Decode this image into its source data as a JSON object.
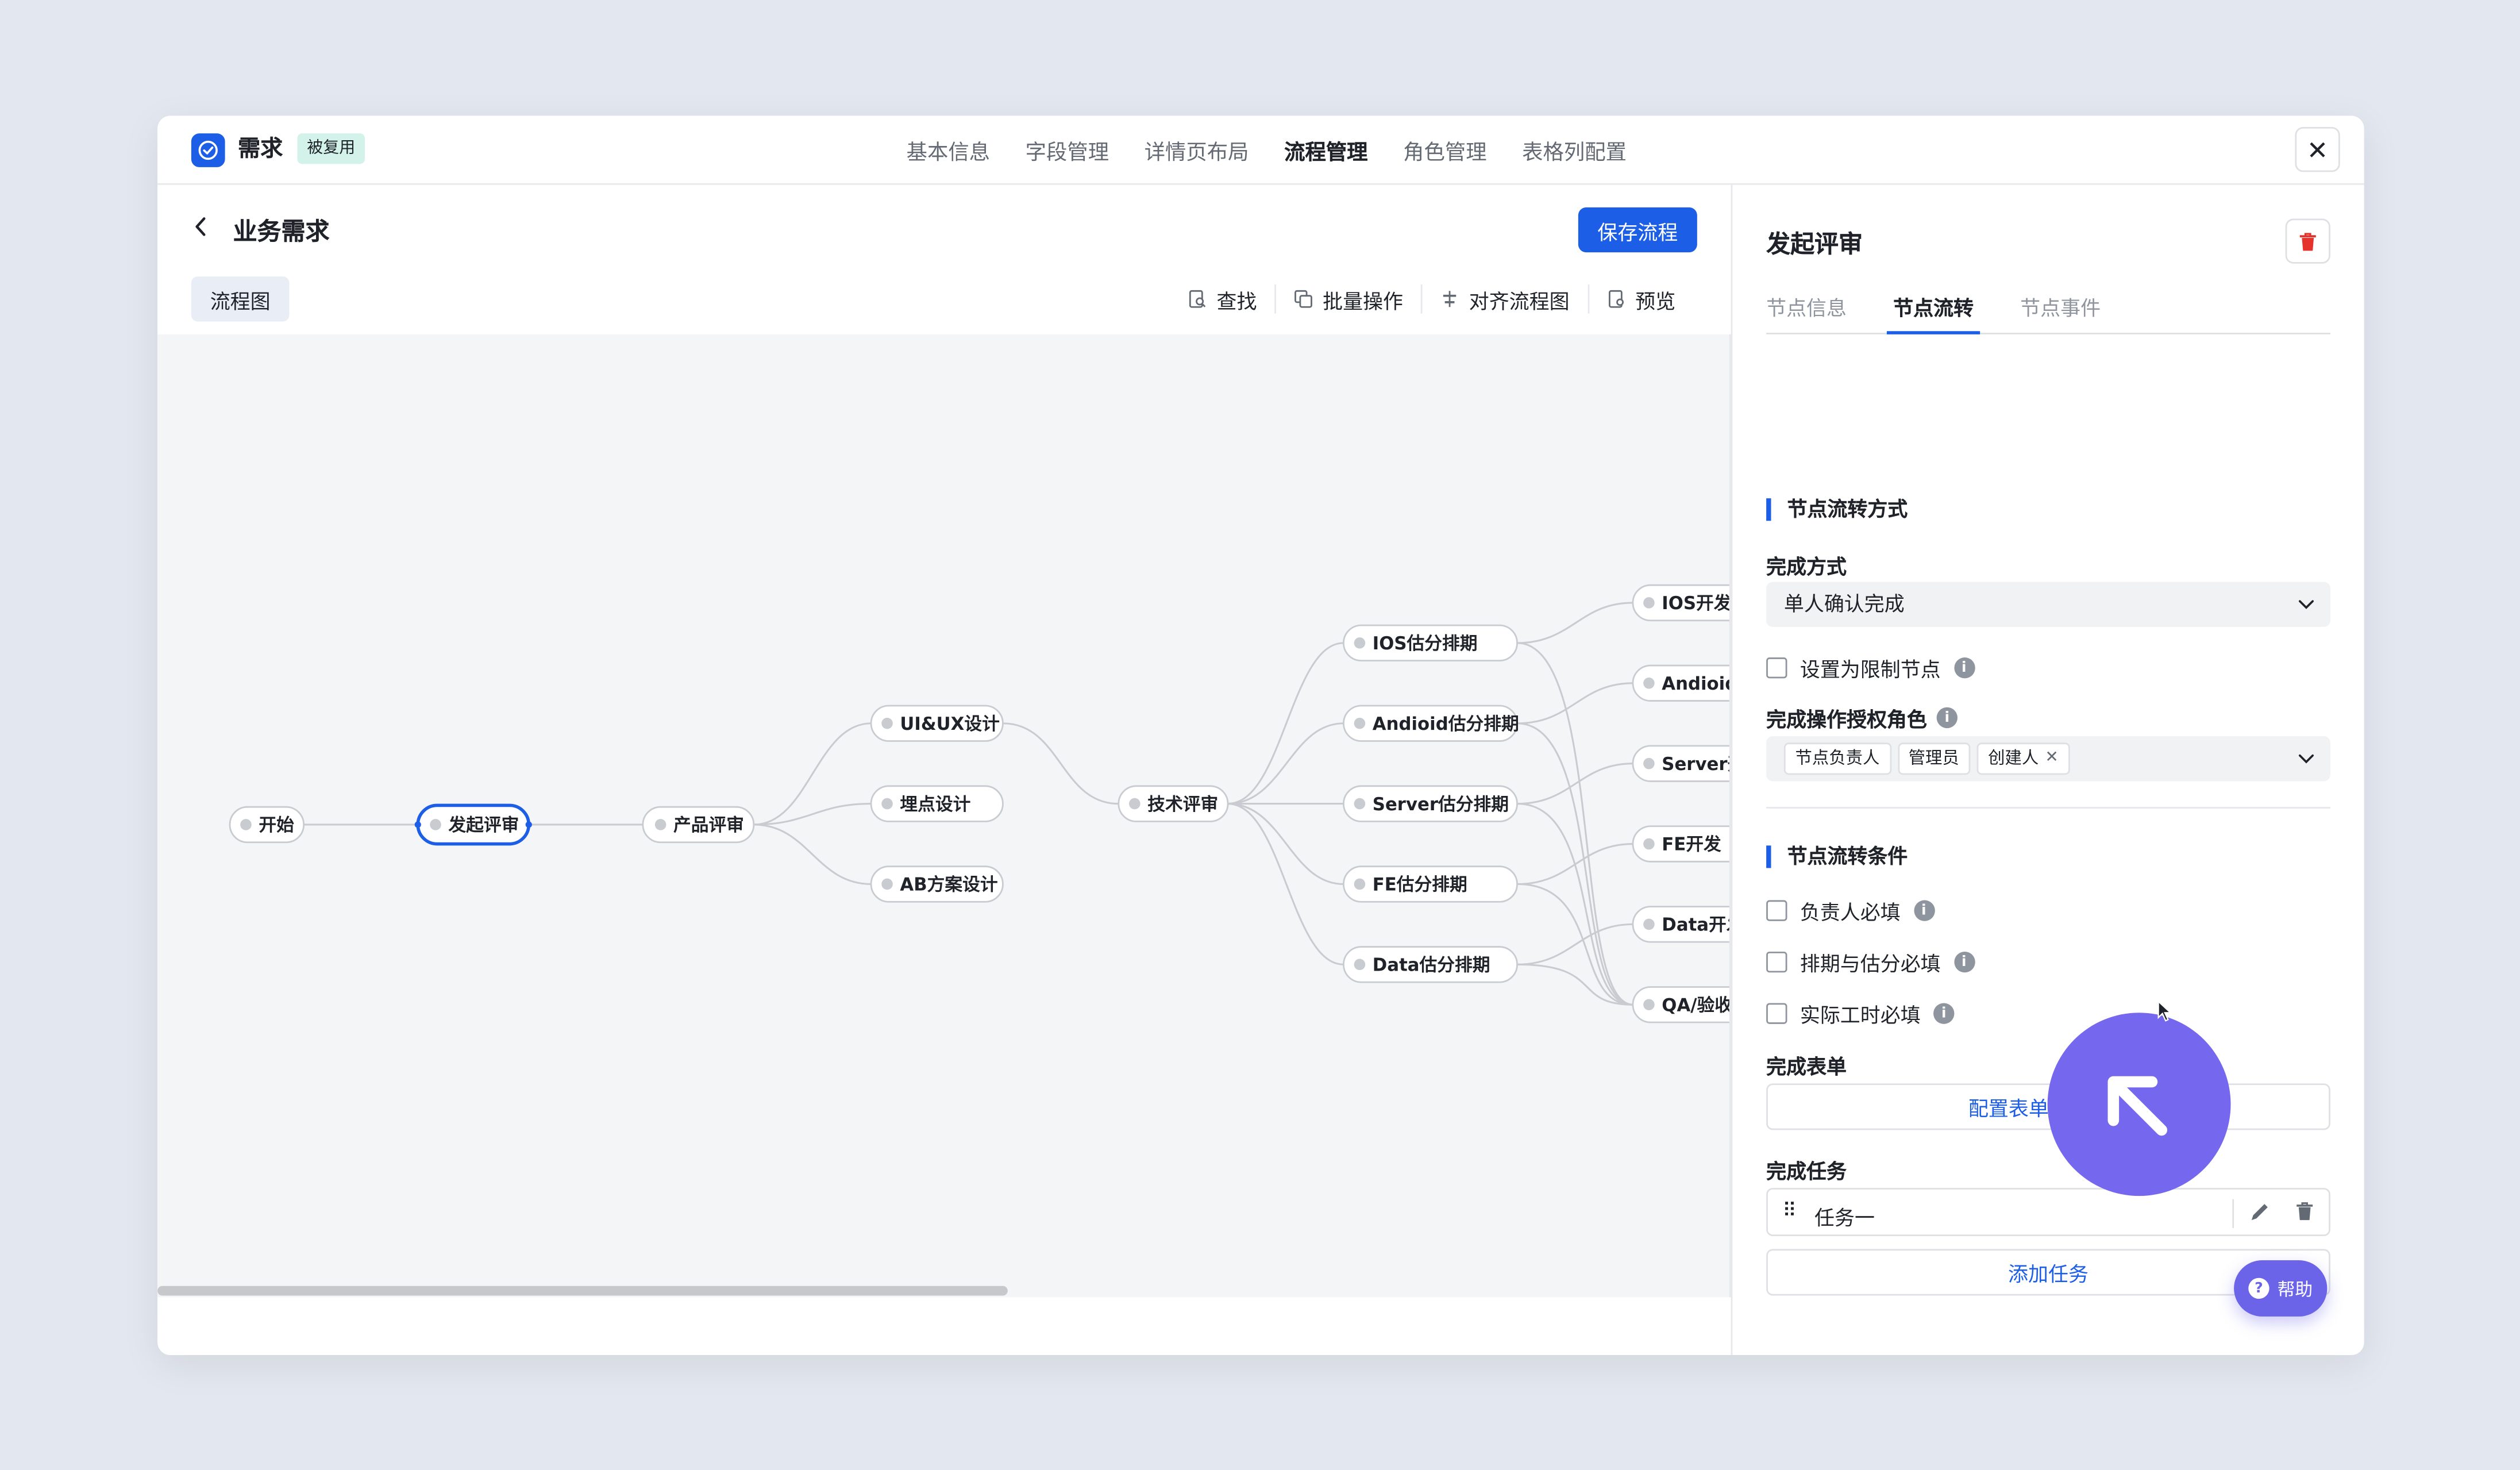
{
  "app": {
    "title": "需求",
    "badge": "被复用",
    "tabs": [
      "基本信息",
      "字段管理",
      "详情页布局",
      "流程管理",
      "角色管理",
      "表格列配置"
    ],
    "active_tab": "流程管理",
    "close_icon": "close-icon",
    "accent_color": "#1c5fe6"
  },
  "header": {
    "back_icon": "chevron-left-icon",
    "title": "业务需求",
    "save_label": "保存流程"
  },
  "toolbar": {
    "flow_tab": "流程图",
    "find": "查找",
    "batch": "批量操作",
    "align": "对齐流程图",
    "preview": "预览"
  },
  "flow": {
    "nodes": {
      "start": "开始",
      "launch_review": "发起评审",
      "product_review": "产品评审",
      "uiux": "UI&UX设计",
      "tracking": "埋点设计",
      "ab": "AB方案设计",
      "tech_review": "技术评审",
      "ios_est": "IOS估分排期",
      "android_est": "Andioid估分排期",
      "server_est": "Server估分排期",
      "fe_est": "FE估分排期",
      "data_est": "Data估分排期",
      "ios_dev": "IOS开发",
      "android_dev": "Andioid开发",
      "server_dev": "Server开发",
      "fe_dev": "FE开发",
      "data_dev": "Data开发",
      "qa": "QA/验收"
    },
    "selected": "发起评审"
  },
  "panel": {
    "title": "发起评审",
    "tabs": [
      "节点信息",
      "节点流转",
      "节点事件"
    ],
    "active_tab": "节点流转",
    "section1": "节点流转方式",
    "complete_mode_label": "完成方式",
    "complete_mode_value": "单人确认完成",
    "restrict_node": "设置为限制节点",
    "roles_label": "完成操作授权角色",
    "roles": [
      "节点负责人",
      "管理员",
      "创建人"
    ],
    "section2": "节点流转条件",
    "cond_owner": "负责人必填",
    "cond_schedule": "排期与估分必填",
    "cond_hours": "实际工时必填",
    "form_label": "完成表单",
    "form_button": "配置表单·2个字段",
    "task_label": "完成任务",
    "task_name": "任务一",
    "add_task": "添加任务"
  },
  "help": {
    "label": "帮助"
  }
}
